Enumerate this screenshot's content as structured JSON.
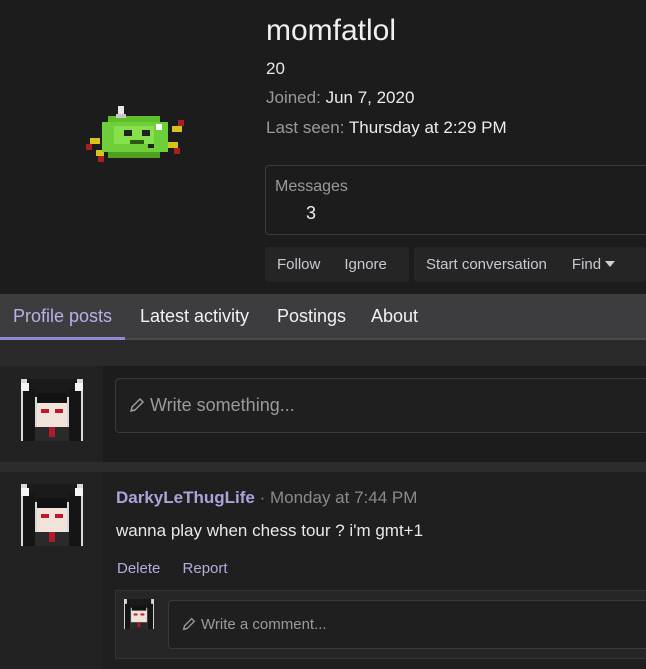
{
  "profile": {
    "username": "momfatlol",
    "user_title": "20",
    "joined_label": "Joined:",
    "joined_value": "Jun 7, 2020",
    "last_seen_label": "Last seen:",
    "last_seen_value": "Thursday at 2:29 PM",
    "stats": {
      "label": "Messages",
      "value": "3"
    },
    "actions": {
      "follow": "Follow",
      "ignore": "Ignore",
      "start_conversation": "Start conversation",
      "find": "Find"
    },
    "avatar_icon": "pixel-spider-sprite-icon"
  },
  "tabs": [
    {
      "label": "Profile posts",
      "active": true
    },
    {
      "label": "Latest activity"
    },
    {
      "label": "Postings"
    },
    {
      "label": "About"
    }
  ],
  "compose": {
    "placeholder": "Write something...",
    "icon": "pencil-icon"
  },
  "post": {
    "author": "DarkyLeThugLife",
    "separator": " · ",
    "time": "Monday at 7:44 PM",
    "body": "wanna play when chess tour ? i'm gmt+1",
    "actions": {
      "delete": "Delete",
      "report": "Report"
    },
    "comment_placeholder": "Write a comment..."
  },
  "colors": {
    "accent": "#aaa3dc",
    "active_tab": "#b7b2e8",
    "background": "#1e1e1e",
    "tab_bar": "#3d3d3f"
  }
}
